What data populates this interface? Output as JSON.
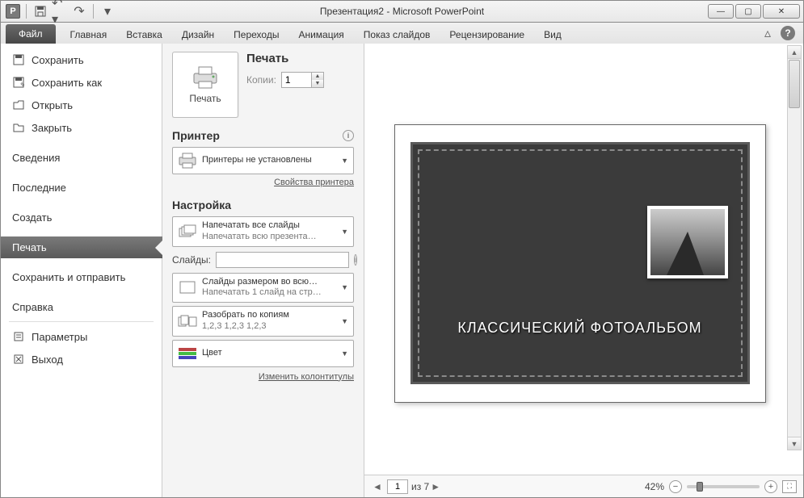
{
  "titlebar": {
    "title": "Презентация2 - Microsoft PowerPoint"
  },
  "ribbon": {
    "file": "Файл",
    "tabs": [
      "Главная",
      "Вставка",
      "Дизайн",
      "Переходы",
      "Анимация",
      "Показ слайдов",
      "Рецензирование",
      "Вид"
    ]
  },
  "nav": {
    "save": "Сохранить",
    "saveas": "Сохранить как",
    "open": "Открыть",
    "close": "Закрыть",
    "info": "Сведения",
    "recent": "Последние",
    "new": "Создать",
    "print": "Печать",
    "share": "Сохранить и отправить",
    "help": "Справка",
    "options": "Параметры",
    "exit": "Выход"
  },
  "print": {
    "header": "Печать",
    "print_button": "Печать",
    "copies_label": "Копии:",
    "copies_value": "1",
    "printer_header": "Принтер",
    "printer_none": "Принтеры не установлены",
    "printer_props": "Свойства принтера",
    "settings_header": "Настройка",
    "all_slides_main": "Напечатать все слайды",
    "all_slides_sub": "Напечатать всю презента…",
    "slides_label": "Слайды:",
    "layout_main": "Слайды размером во всю…",
    "layout_sub": "Напечатать 1 слайд на стр…",
    "collate_main": "Разобрать по копиям",
    "collate_sub": "1,2,3   1,2,3   1,2,3",
    "color": "Цвет",
    "edit_hf": "Изменить колонтитулы"
  },
  "preview": {
    "slide_title": "КЛАССИЧЕСКИЙ ФОТОАЛЬБОМ",
    "page_current": "1",
    "page_total_label": "из 7",
    "zoom": "42%"
  }
}
